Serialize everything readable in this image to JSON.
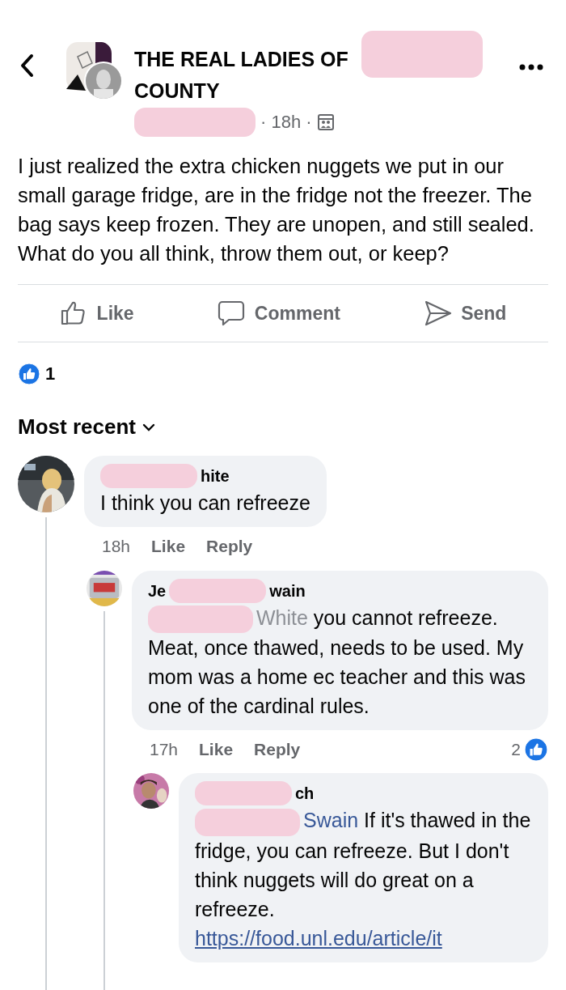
{
  "header": {
    "title_lines": [
      "THE REAL LADIES OF",
      "COUNTY"
    ],
    "meta": "· 18h ·"
  },
  "post": {
    "text": "I just realized the extra chicken nuggets we put in our small garage fridge, are in the fridge not the freezer. The bag says keep frozen. They are unopen, and still sealed. What do you all think, throw them out, or keep?"
  },
  "actions": [
    {
      "label": "Like",
      "kind": "like"
    },
    {
      "label": "Comment",
      "kind": "comment"
    },
    {
      "label": "Send",
      "kind": "send"
    }
  ],
  "reactions": {
    "count": "1"
  },
  "sort": {
    "label": "Most recent"
  },
  "comments": [
    {
      "author_parts": [
        "hite"
      ],
      "body": [
        {
          "kind": "plain",
          "text": "I think you can refreeze"
        }
      ],
      "time": "18h",
      "actions": [
        "Like",
        "Reply"
      ],
      "children": [
        {
          "author_parts": [
            "Je",
            "wain"
          ],
          "body": [
            {
              "kind": "faded",
              "text": "White"
            },
            {
              "kind": "plain",
              "text": "you cannot refreeze. Meat, once thawed, needs to be used. My mom was a home ec teacher and this was one of the cardinal rules."
            }
          ],
          "time": "17h",
          "actions": [
            "Like",
            "Reply"
          ],
          "reactions": "2",
          "children": [
            {
              "author_parts": [
                "ch"
              ],
              "body": [
                {
                  "kind": "link",
                  "text": "Swain"
                },
                {
                  "kind": "plain",
                  "text": "If it's thawed in the fridge, you can refreeze. But I don't think nuggets will do great on a refreeze."
                }
              ],
              "link": "https://food.unl.edu/article/it"
            }
          ]
        }
      ]
    }
  ]
}
